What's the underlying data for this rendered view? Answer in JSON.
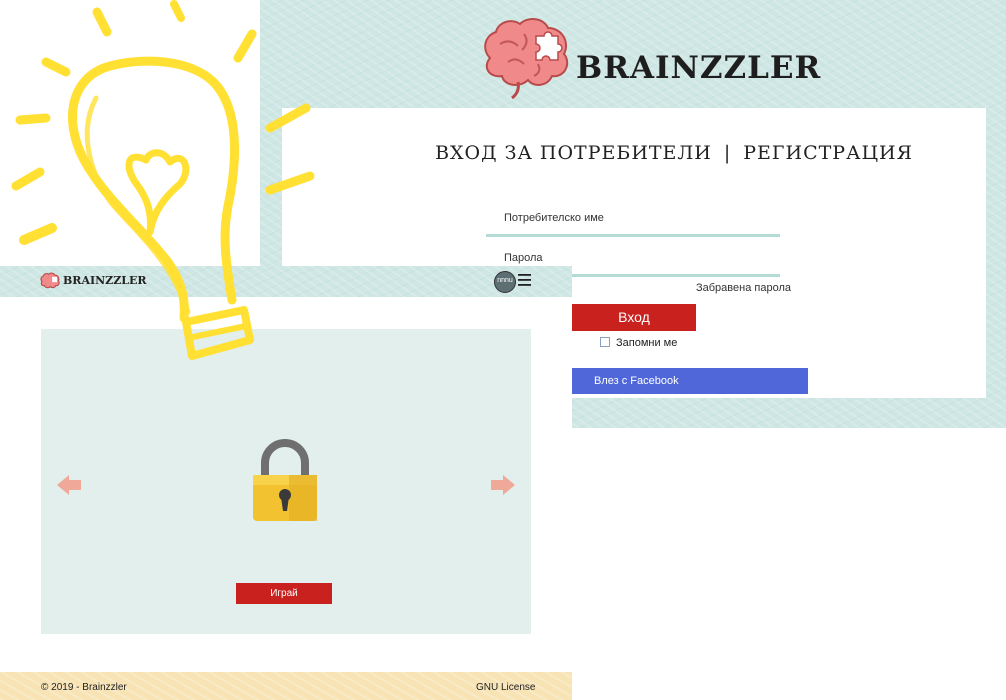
{
  "brand": {
    "name": "BRAINZZLER"
  },
  "login": {
    "tab_login": "ВХОД ЗА ПОТРЕБИТЕЛИ",
    "separator": "|",
    "tab_register": "РЕГИСТРАЦИЯ",
    "username_label": "Потребителско име",
    "password_label": "Парола",
    "forgot_password": "Забравена парола",
    "login_button": "Вход",
    "remember_me": "Запомни ме",
    "facebook_button": "Влез с Facebook"
  },
  "game": {
    "header": {
      "logo_text": "BRAINZZLER",
      "avatar_text": "nnnu"
    },
    "play_button": "Играй",
    "footer": {
      "copyright": "© 2019 - Brainzzler",
      "license": "GNU License"
    }
  },
  "colors": {
    "accent_red": "#c9211e",
    "facebook_blue": "#4f67d8",
    "mint_background": "#cfe7e4",
    "panel_background": "#e2efed",
    "bulb_yellow": "#ffe033",
    "brain_pink": "#f08a8a",
    "arrow_salmon": "#f0a898",
    "footer_sand": "#f7e3b4"
  },
  "icons": [
    "brain-puzzle-logo-icon",
    "padlock-icon",
    "arrow-left-icon",
    "arrow-right-icon",
    "hamburger-menu-icon",
    "lightbulb-icon"
  ]
}
